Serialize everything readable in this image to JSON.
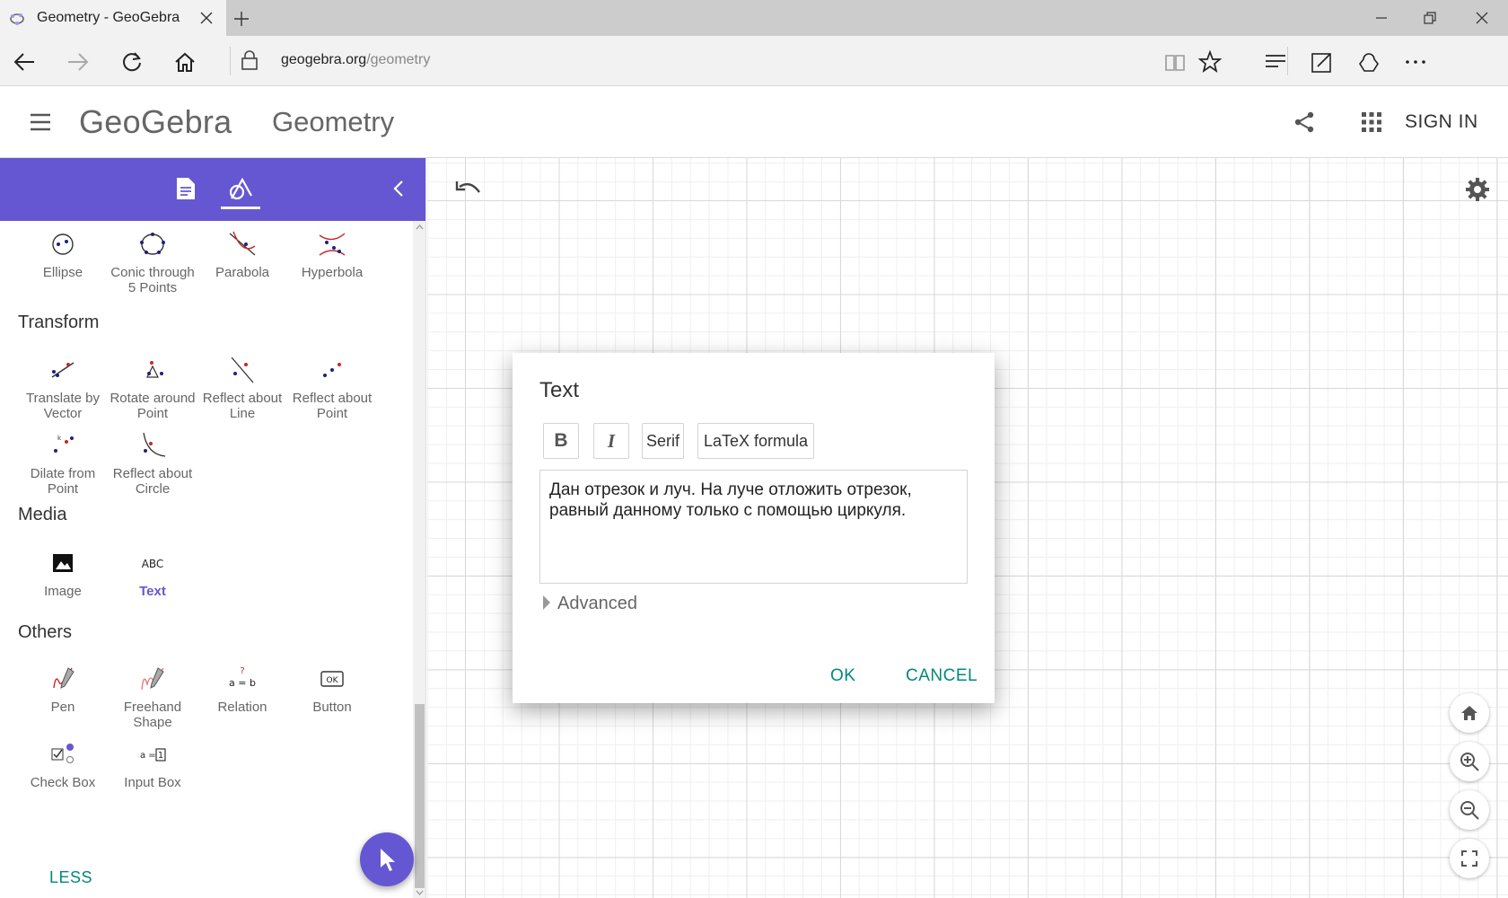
{
  "browser": {
    "tab_title": "Geometry - GeoGebra",
    "url_host": "geogebra.org",
    "url_path": "/geometry"
  },
  "header": {
    "brand": "GeoGebra",
    "app_name": "Geometry",
    "sign_in": "SIGN IN"
  },
  "tools": {
    "conics": [
      {
        "label": "Ellipse",
        "icon": "ellipse-icon"
      },
      {
        "label": "Conic through 5 Points",
        "icon": "conic-5-points-icon"
      },
      {
        "label": "Parabola",
        "icon": "parabola-icon"
      },
      {
        "label": "Hyperbola",
        "icon": "hyperbola-icon"
      }
    ],
    "transform_title": "Transform",
    "transform": [
      {
        "label": "Translate by Vector",
        "icon": "translate-vector-icon"
      },
      {
        "label": "Rotate around Point",
        "icon": "rotate-point-icon"
      },
      {
        "label": "Reflect about Line",
        "icon": "reflect-line-icon"
      },
      {
        "label": "Reflect about Point",
        "icon": "reflect-point-icon"
      },
      {
        "label": "Dilate from Point",
        "icon": "dilate-point-icon"
      },
      {
        "label": "Reflect about Circle",
        "icon": "reflect-circle-icon"
      }
    ],
    "media_title": "Media",
    "media": [
      {
        "label": "Image",
        "icon": "image-icon"
      },
      {
        "label": "Text",
        "icon": "text-abc-icon",
        "icon_text": "ABC",
        "selected": true
      }
    ],
    "others_title": "Others",
    "others": [
      {
        "label": "Pen",
        "icon": "pen-icon"
      },
      {
        "label": "Freehand Shape",
        "icon": "freehand-shape-icon"
      },
      {
        "label": "Relation",
        "icon": "relation-icon",
        "icon_text": "a = b",
        "icon_mark": "?"
      },
      {
        "label": "Button",
        "icon": "button-icon",
        "icon_text": "OK"
      },
      {
        "label": "Check Box",
        "icon": "check-box-icon"
      },
      {
        "label": "Input Box",
        "icon": "input-box-icon",
        "icon_text_a": "a =",
        "icon_text_b": "1"
      }
    ],
    "less_label": "LESS"
  },
  "dialog": {
    "title": "Text",
    "bold_label": "B",
    "italic_label": "I",
    "serif_label": "Serif",
    "latex_label": "LaTeX formula",
    "text_line1": "Дан отрезок и луч. На луче отложить отрезок,",
    "text_line2": "равный данному только с помощью циркуля.",
    "advanced_label": "Advanced",
    "ok_label": "OK",
    "cancel_label": "CANCEL"
  },
  "colors": {
    "accent": "#6557d2",
    "button_text": "#00897b",
    "point_blue": "#1a237e",
    "object_red": "#c62828"
  }
}
